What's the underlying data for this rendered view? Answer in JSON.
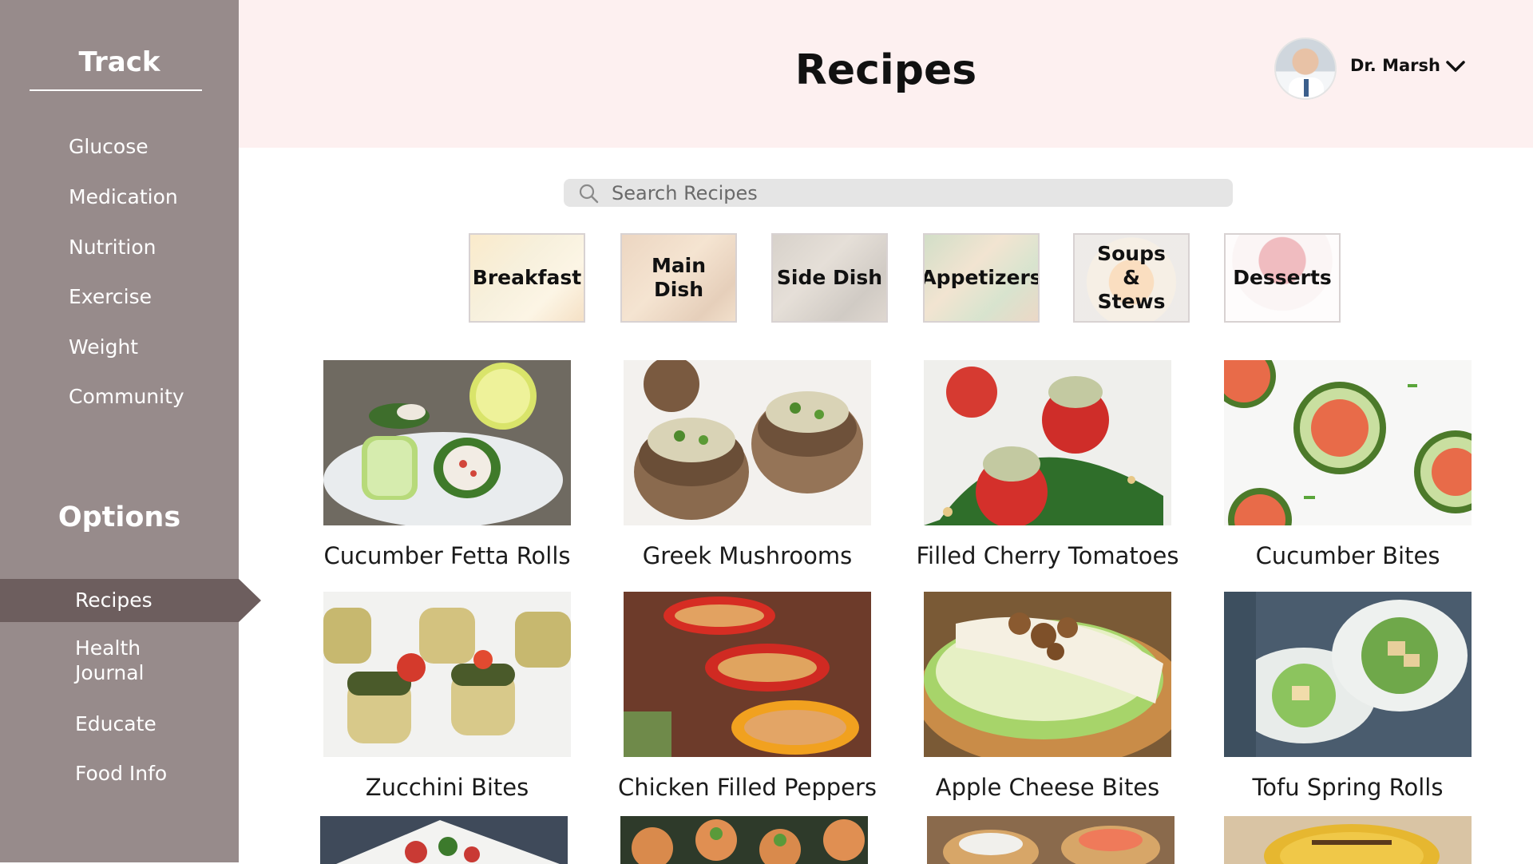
{
  "sidebar": {
    "track_title": "Track",
    "track_items": [
      "Glucose",
      "Medication",
      "Nutrition",
      "Exercise",
      "Weight",
      "Community"
    ],
    "options_title": "Options",
    "option_items": [
      "Recipes",
      "Health Journal",
      "Educate",
      "Food Info"
    ],
    "active_item": "Recipes"
  },
  "header": {
    "title": "Recipes",
    "user_name": "Dr. Marsh",
    "avatar": "doctor-avatar"
  },
  "search": {
    "placeholder": "Search Recipes",
    "icon": "search-icon"
  },
  "categories": [
    "Breakfast",
    "Main Dish",
    "Side Dish",
    "Appetizers",
    "Soups & Stews",
    "Desserts"
  ],
  "recipes": [
    "Cucumber Fetta Rolls",
    "Greek Mushrooms",
    "Filled Cherry Tomatoes",
    "Cucumber Bites",
    "Zucchini Bites",
    "Chicken Filled Peppers",
    "Apple Cheese Bites",
    "Tofu Spring Rolls"
  ],
  "colors": {
    "sidebar": "#978b8b",
    "sidebar_active": "#6d5e5e",
    "header_bg": "#fdf0f0",
    "search_bg": "#e5e5e5"
  }
}
